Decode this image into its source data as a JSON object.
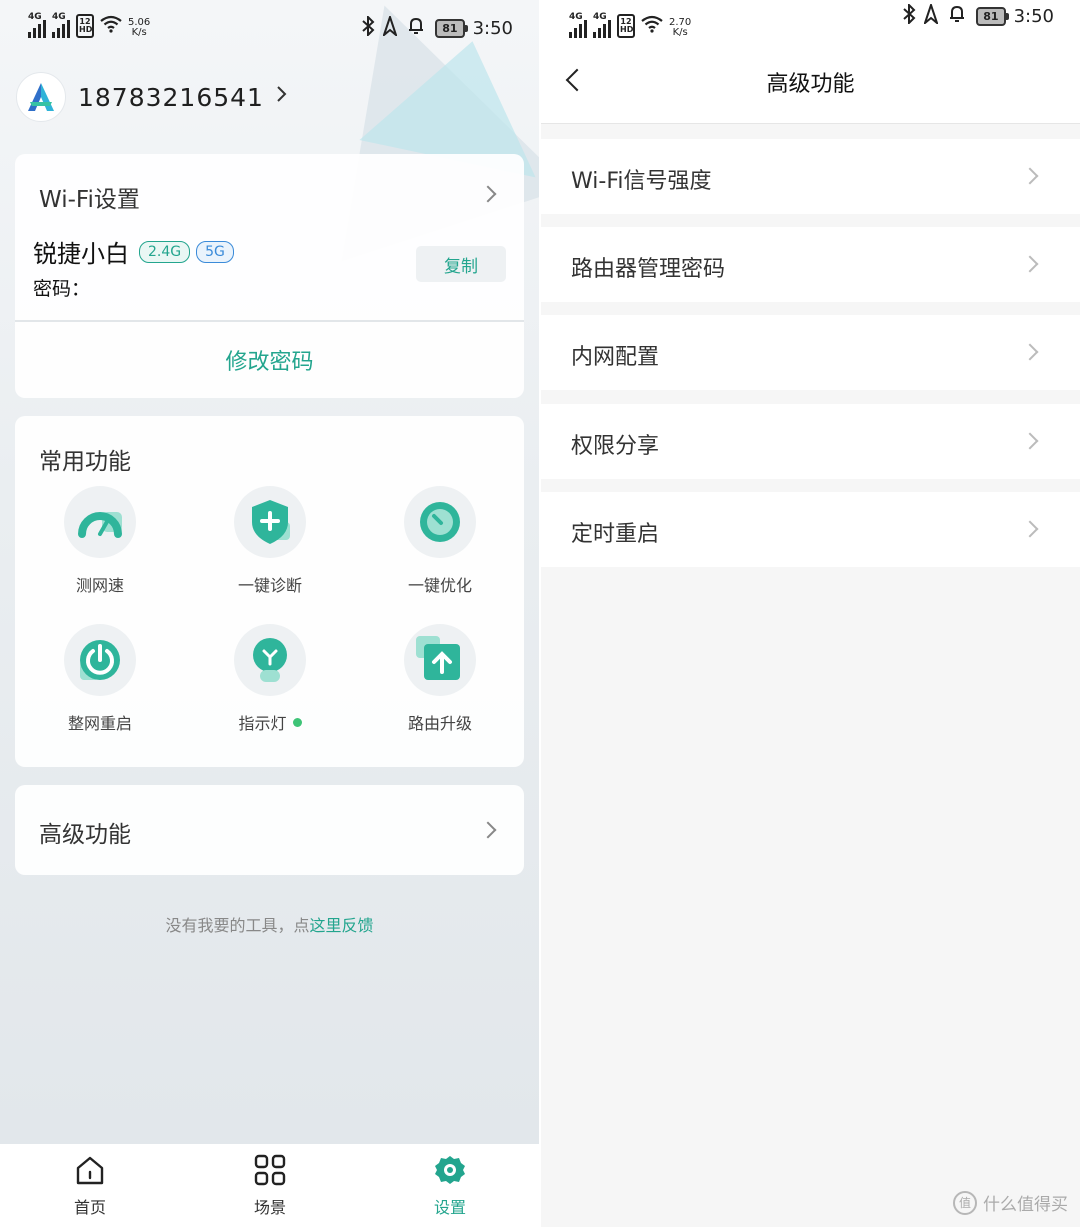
{
  "status_left": {
    "speed_value": "5.06",
    "speed_unit": "K/s",
    "time": "3:50",
    "battery": "81",
    "net_label": "4G",
    "hd_top": "12",
    "hd_bottom": "HD"
  },
  "status_right": {
    "speed_value": "2.70",
    "speed_unit": "K/s",
    "time": "3:50",
    "battery": "81",
    "net_label": "4G",
    "hd_top": "12",
    "hd_bottom": "HD"
  },
  "account": {
    "phone": "18783216541"
  },
  "wifi_card": {
    "title": "Wi-Fi设置",
    "ssid": "锐捷小白",
    "band_24": "2.4G",
    "band_5": "5G",
    "password_label": "密码：",
    "copy_label": "复制",
    "modify_label": "修改密码"
  },
  "functions": {
    "title": "常用功能",
    "items": [
      {
        "label": "测网速",
        "icon": "speedometer-icon"
      },
      {
        "label": "一键诊断",
        "icon": "shield-plus-icon"
      },
      {
        "label": "一键优化",
        "icon": "timer-icon"
      },
      {
        "label": "整网重启",
        "icon": "power-icon"
      },
      {
        "label": "指示灯",
        "icon": "bulb-icon"
      },
      {
        "label": "路由升级",
        "icon": "upgrade-icon"
      }
    ]
  },
  "advanced": {
    "title": "高级功能"
  },
  "feedback": {
    "text": "没有我要的工具，点",
    "link": "这里反馈"
  },
  "tabs": [
    {
      "label": "首页",
      "icon": "home-icon"
    },
    {
      "label": "场景",
      "icon": "grid-icon"
    },
    {
      "label": "设置",
      "icon": "gear-icon"
    }
  ],
  "colors": {
    "accent": "#23a58e",
    "blue_tag": "#3b8bd9",
    "indicator_dot": "#3ec477"
  },
  "advanced_page": {
    "title": "高级功能",
    "items": [
      "Wi-Fi信号强度",
      "路由器管理密码",
      "内网配置",
      "权限分享",
      "定时重启"
    ]
  },
  "watermark": {
    "text": "什么值得买",
    "logo": "值"
  }
}
